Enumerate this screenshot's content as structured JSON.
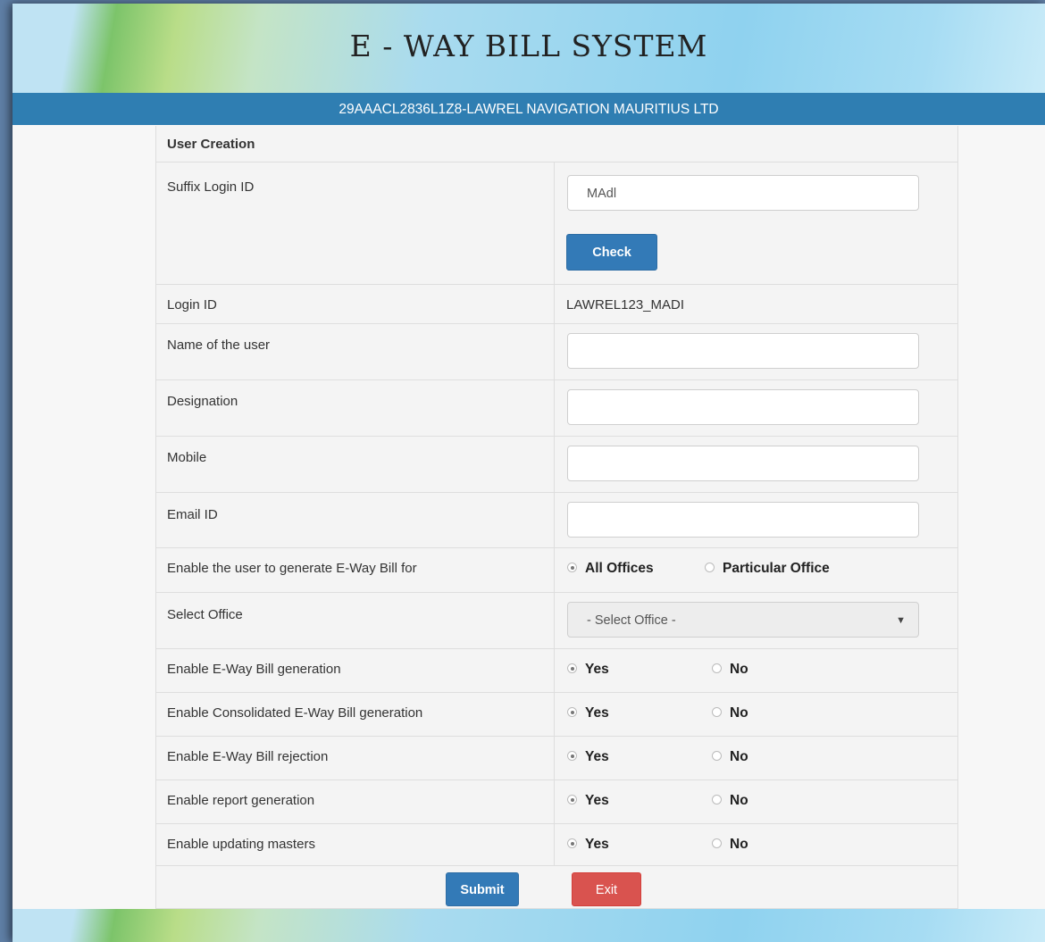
{
  "header": {
    "title": "E - WAY BILL SYSTEM",
    "gstin_name": "29AAACL2836L1Z8-LAWREL NAVIGATION MAURITIUS LTD"
  },
  "form": {
    "section_title": "User Creation",
    "suffix_label": "Suffix Login ID",
    "suffix_value": "MAdl",
    "check_label": "Check",
    "login_id_label": "Login ID",
    "login_id_value": "LAWREL123_MADI",
    "name_label": "Name of the user",
    "name_value": "",
    "designation_label": "Designation",
    "designation_value": "",
    "mobile_label": "Mobile",
    "mobile_value": "",
    "email_label": "Email ID",
    "email_value": "",
    "enable_for_label": "Enable the user to generate E-Way Bill for",
    "enable_for_options": [
      "All Offices",
      "Particular Office"
    ],
    "enable_for_selected": "All Offices",
    "select_office_label": "Select Office",
    "select_office_value": "- Select Office -",
    "permissions": [
      {
        "label": "Enable E-Way Bill generation",
        "yes": "Yes",
        "no": "No",
        "selected": "Yes"
      },
      {
        "label": "Enable Consolidated E-Way Bill generation",
        "yes": "Yes",
        "no": "No",
        "selected": "Yes"
      },
      {
        "label": "Enable E-Way Bill rejection",
        "yes": "Yes",
        "no": "No",
        "selected": "Yes"
      },
      {
        "label": "Enable report generation",
        "yes": "Yes",
        "no": "No",
        "selected": "Yes"
      },
      {
        "label": "Enable updating masters",
        "yes": "Yes",
        "no": "No",
        "selected": "Yes"
      }
    ],
    "submit_label": "Submit",
    "exit_label": "Exit"
  },
  "colors": {
    "header_bar": "#2f7eb2",
    "primary_button": "#337ab7",
    "danger_button": "#d9534f"
  }
}
